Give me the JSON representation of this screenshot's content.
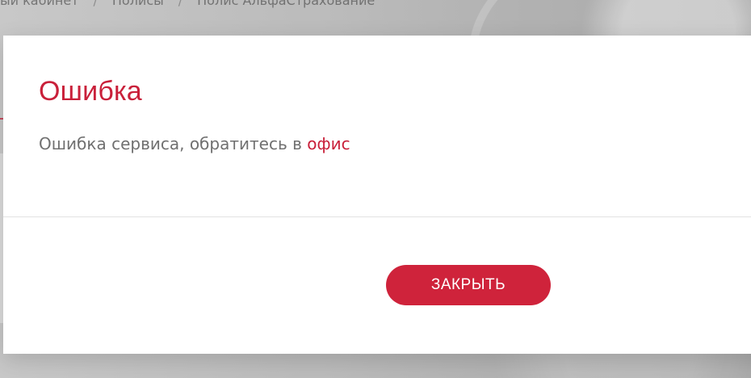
{
  "background": {
    "breadcrumb": {
      "items": [
        "ый кабинет",
        "Полисы",
        "Полис АльфаСтрахование"
      ],
      "separator": "/"
    }
  },
  "modal": {
    "title": "Ошибка",
    "message_text": "Ошибка сервиса, обратитесь в",
    "message_link": "офис",
    "close_button_label": "ЗАКРЫТЬ"
  },
  "colors": {
    "accent": "#cf233b",
    "text_secondary": "#707070",
    "background_overlay": "#cfcfcf",
    "modal_background": "#ffffff"
  }
}
